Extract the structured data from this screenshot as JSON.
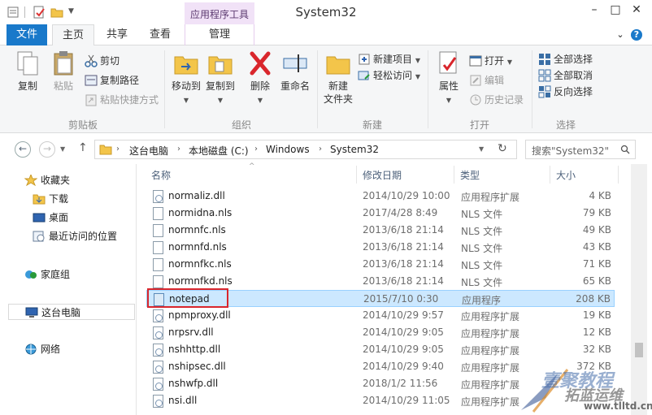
{
  "window": {
    "title": "System32",
    "context_tab": "应用程序工具",
    "controls": [
      "–",
      "□",
      "✕"
    ]
  },
  "tabs": [
    {
      "label": "文件"
    },
    {
      "label": "主页"
    },
    {
      "label": "共享"
    },
    {
      "label": "查看"
    },
    {
      "label": "管理"
    }
  ],
  "ribbon": {
    "clipboard": {
      "label": "剪贴板",
      "copy": "复制",
      "paste": "粘贴",
      "cut": "剪切",
      "copy_path": "复制路径",
      "paste_shortcut": "粘贴快捷方式"
    },
    "organize": {
      "label": "组织",
      "move_to": "移动到",
      "copy_to": "复制到",
      "delete": "删除",
      "rename": "重命名"
    },
    "new": {
      "label": "新建",
      "new_folder": "新建\n文件夹",
      "new_item": "新建项目",
      "easy_access": "轻松访问"
    },
    "open": {
      "label": "打开",
      "properties": "属性",
      "open": "打开",
      "edit": "编辑",
      "history": "历史记录"
    },
    "select": {
      "label": "选择",
      "select_all": "全部选择",
      "select_none": "全部取消",
      "invert": "反向选择"
    }
  },
  "address": {
    "crumbs": [
      "这台电脑",
      "本地磁盘 (C:)",
      "Windows",
      "System32"
    ],
    "search_placeholder": "搜索\"System32\""
  },
  "navpane": {
    "favorites": "收藏夹",
    "downloads": "下载",
    "desktop": "桌面",
    "recent": "最近访问的位置",
    "homegroup": "家庭组",
    "this_pc": "这台电脑",
    "network": "网络"
  },
  "columns": {
    "name": "名称",
    "date": "修改日期",
    "type": "类型",
    "size": "大小"
  },
  "files": [
    {
      "name": "normaliz.dll",
      "date": "2014/10/29 10:00",
      "type": "应用程序扩展",
      "size": "4 KB",
      "kind": "dll"
    },
    {
      "name": "normidna.nls",
      "date": "2017/4/28 8:49",
      "type": "NLS 文件",
      "size": "79 KB",
      "kind": "nls"
    },
    {
      "name": "normnfc.nls",
      "date": "2013/6/18 21:14",
      "type": "NLS 文件",
      "size": "49 KB",
      "kind": "nls"
    },
    {
      "name": "normnfd.nls",
      "date": "2013/6/18 21:14",
      "type": "NLS 文件",
      "size": "43 KB",
      "kind": "nls"
    },
    {
      "name": "normnfkc.nls",
      "date": "2013/6/18 21:14",
      "type": "NLS 文件",
      "size": "71 KB",
      "kind": "nls"
    },
    {
      "name": "normnfkd.nls",
      "date": "2013/6/18 21:14",
      "type": "NLS 文件",
      "size": "65 KB",
      "kind": "nls"
    },
    {
      "name": "notepad",
      "date": "2015/7/10 0:30",
      "type": "应用程序",
      "size": "208 KB",
      "kind": "exe",
      "selected": true
    },
    {
      "name": "npmproxy.dll",
      "date": "2014/10/29 9:57",
      "type": "应用程序扩展",
      "size": "19 KB",
      "kind": "dll"
    },
    {
      "name": "nrpsrv.dll",
      "date": "2014/10/29 9:05",
      "type": "应用程序扩展",
      "size": "12 KB",
      "kind": "dll"
    },
    {
      "name": "nshhttp.dll",
      "date": "2014/10/29 9:05",
      "type": "应用程序扩展",
      "size": "32 KB",
      "kind": "dll"
    },
    {
      "name": "nshipsec.dll",
      "date": "2014/10/29 9:40",
      "type": "应用程序扩展",
      "size": "372 KB",
      "kind": "dll"
    },
    {
      "name": "nshwfp.dll",
      "date": "2018/1/2 11:56",
      "type": "应用程序扩展",
      "size": "",
      "kind": "dll"
    },
    {
      "name": "nsi.dll",
      "date": "2014/10/29 11:05",
      "type": "应用程序扩展",
      "size": "",
      "kind": "dll"
    }
  ],
  "watermark": {
    "line1": "壹聚教程",
    "line2": "拓蓝运维",
    "url": "www.tlltd.cn"
  },
  "colors": {
    "file_tab": "#1979ca",
    "context_tab": "#f1e2f7",
    "selection": "#cce8ff",
    "highlight_box": "#d9262c"
  }
}
